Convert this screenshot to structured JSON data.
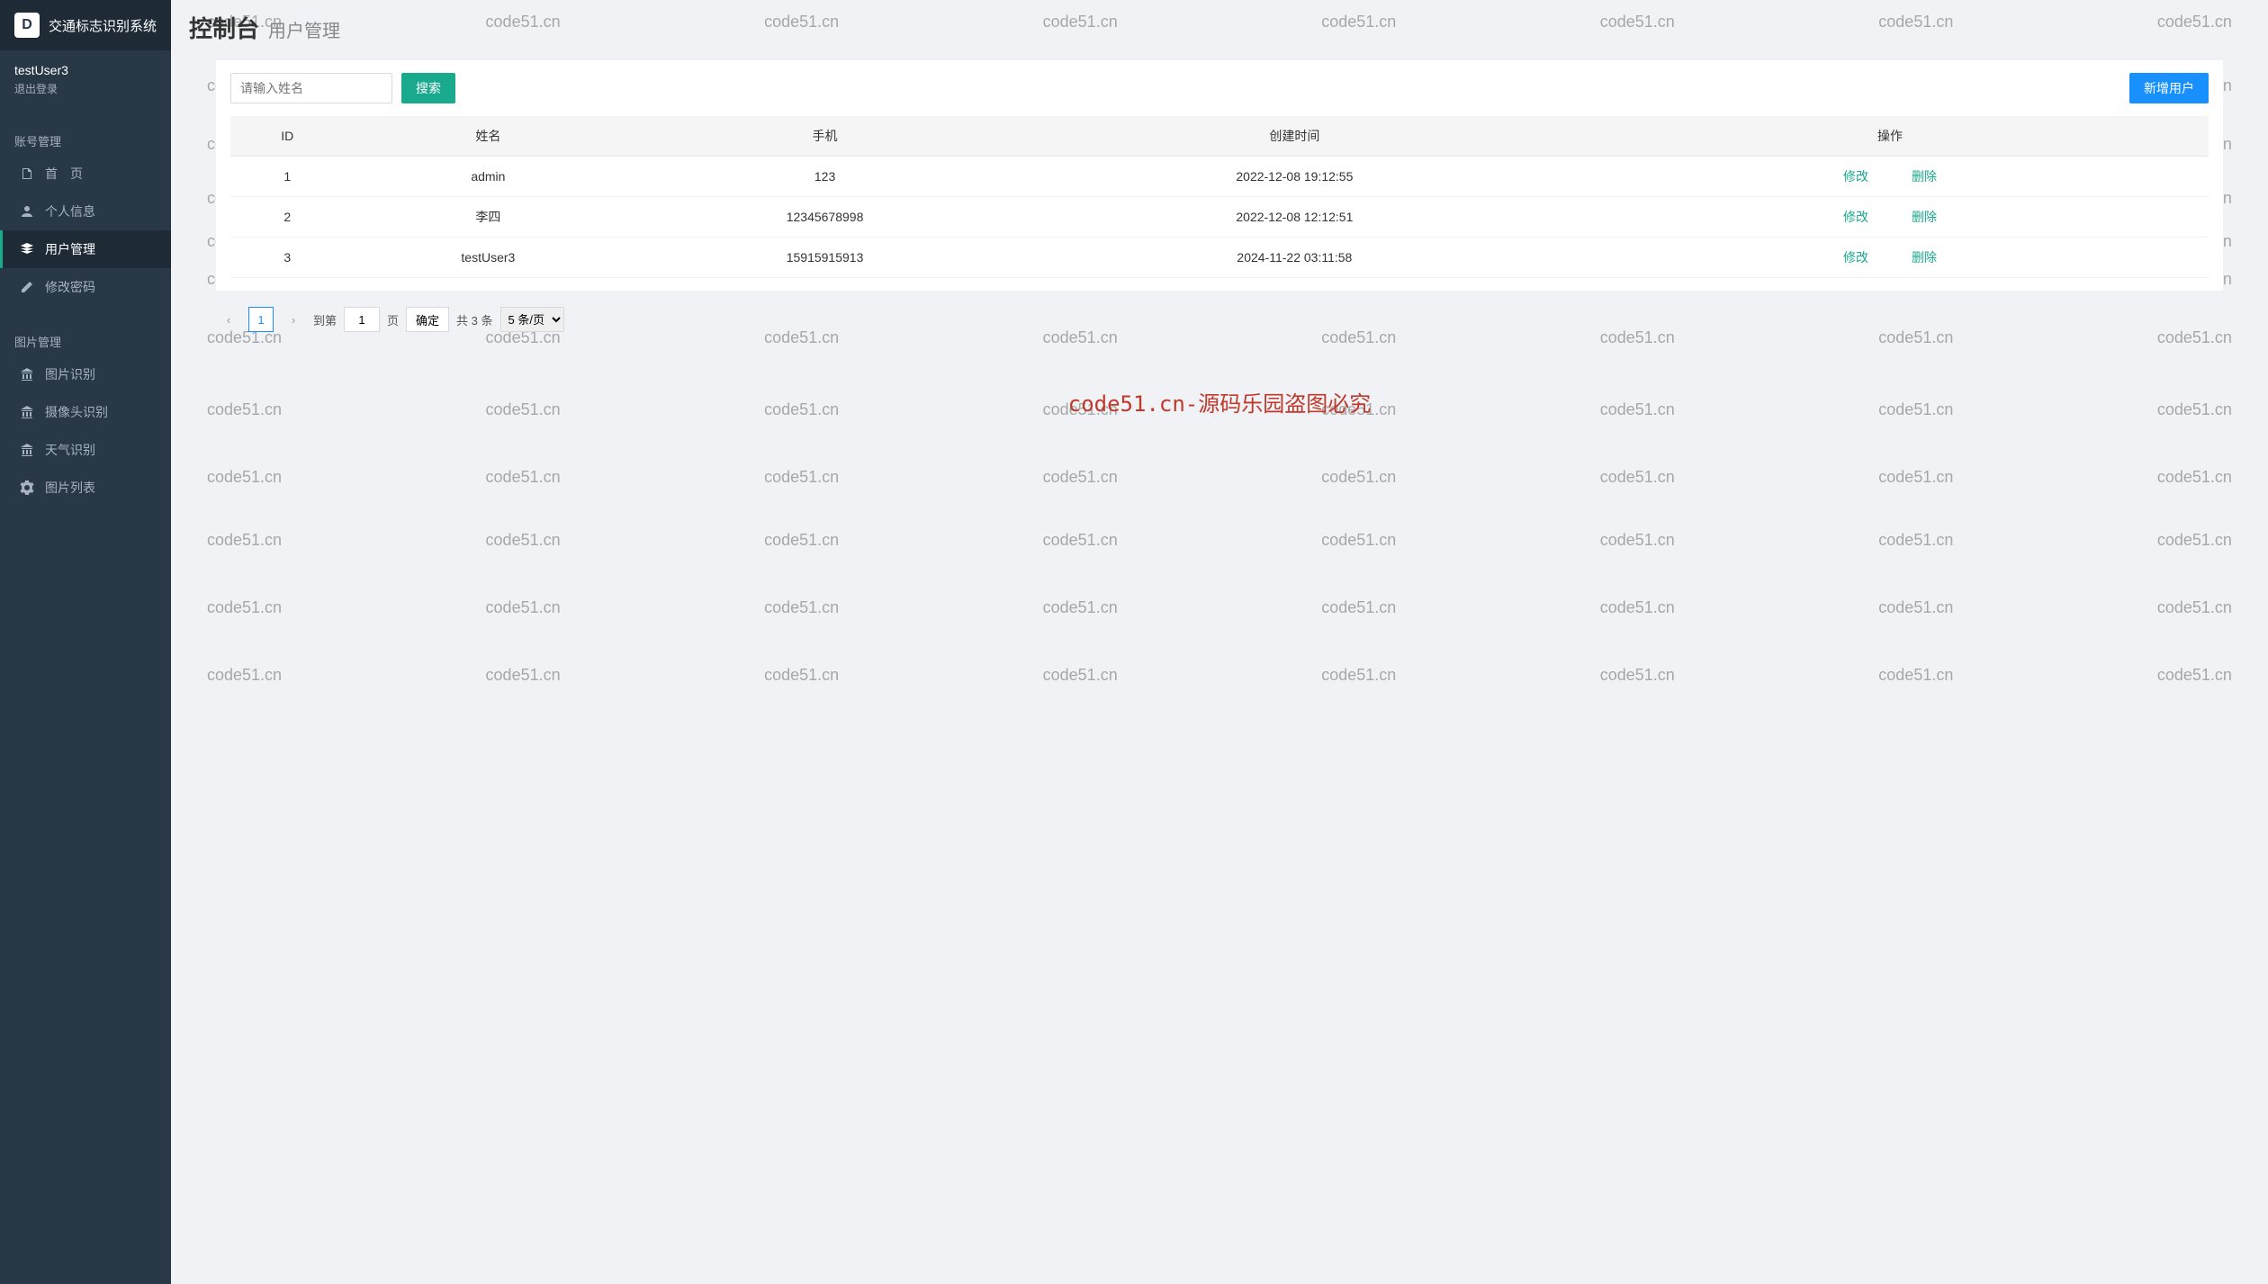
{
  "app": {
    "title": "交通标志识别系统",
    "logo_letter": "D"
  },
  "user": {
    "name": "testUser3",
    "logout_label": "退出登录"
  },
  "nav": {
    "section1": {
      "title": "账号管理",
      "items": [
        {
          "label": "首　页"
        },
        {
          "label": "个人信息"
        },
        {
          "label": "用户管理"
        },
        {
          "label": "修改密码"
        }
      ]
    },
    "section2": {
      "title": "图片管理",
      "items": [
        {
          "label": "图片识别"
        },
        {
          "label": "摄像头识别"
        },
        {
          "label": "天气识别"
        },
        {
          "label": "图片列表"
        }
      ]
    }
  },
  "page": {
    "title_main": "控制台",
    "title_sub": "用户管理"
  },
  "toolbar": {
    "search_placeholder": "请输入姓名",
    "search_button": "搜索",
    "add_button": "新增用户"
  },
  "table": {
    "headers": {
      "id": "ID",
      "name": "姓名",
      "phone": "手机",
      "created": "创建时间",
      "action": "操作"
    },
    "rows": [
      {
        "id": "1",
        "name": "admin",
        "phone": "123",
        "created": "2022-12-08 19:12:55"
      },
      {
        "id": "2",
        "name": "李四",
        "phone": "12345678998",
        "created": "2022-12-08 12:12:51"
      },
      {
        "id": "3",
        "name": "testUser3",
        "phone": "15915915913",
        "created": "2024-11-22 03:11:58"
      }
    ],
    "actions": {
      "edit": "修改",
      "delete": "删除"
    }
  },
  "pagination": {
    "current": "1",
    "goto_prefix": "到第",
    "goto_value": "1",
    "goto_suffix": "页",
    "confirm": "确定",
    "total": "共 3 条",
    "page_size": "5 条/页"
  },
  "watermark": {
    "text": "code51.cn",
    "center": "code51.cn-源码乐园盗图必究"
  }
}
